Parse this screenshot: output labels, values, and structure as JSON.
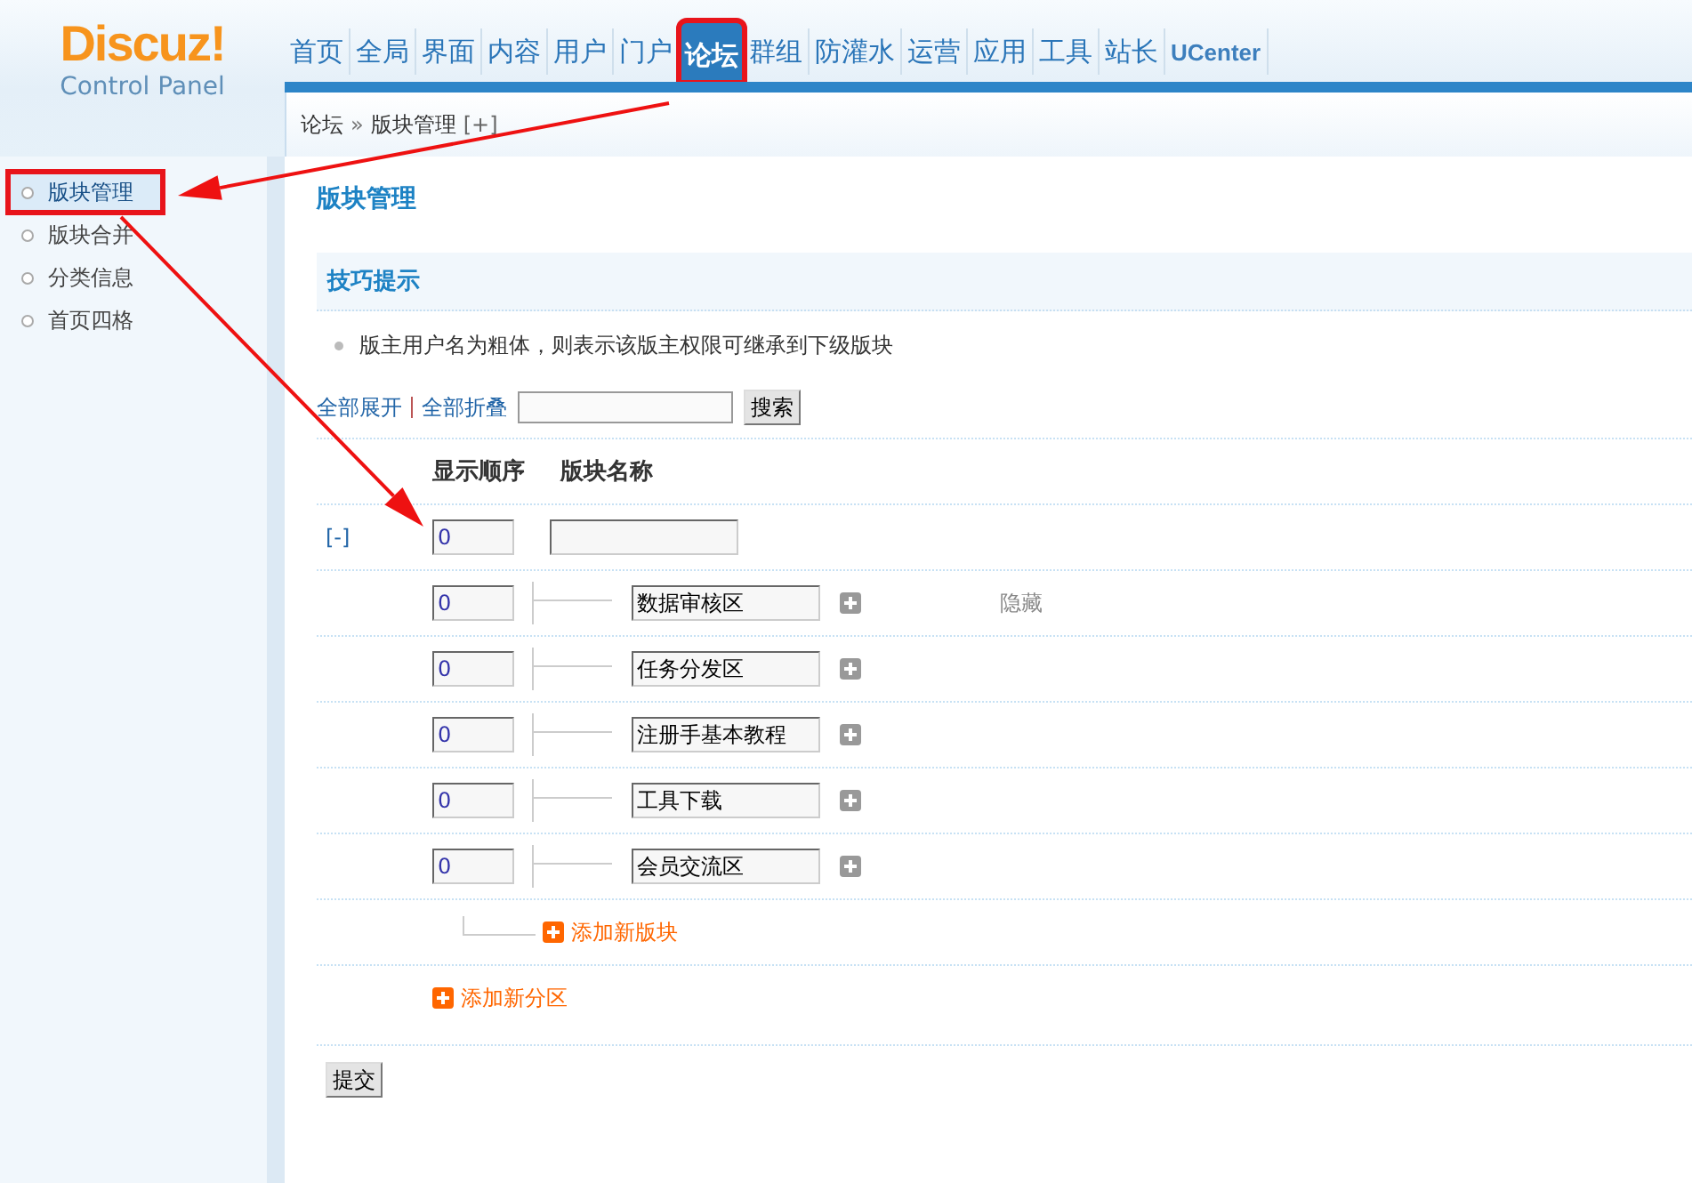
{
  "header": {
    "logo": "Discuz!",
    "subtitle": "Control Panel"
  },
  "nav": [
    {
      "label": "首页",
      "selected": false,
      "highlighted": false
    },
    {
      "label": "全局",
      "selected": false,
      "highlighted": false
    },
    {
      "label": "界面",
      "selected": false,
      "highlighted": false
    },
    {
      "label": "内容",
      "selected": false,
      "highlighted": false
    },
    {
      "label": "用户",
      "selected": false,
      "highlighted": false
    },
    {
      "label": "门户",
      "selected": false,
      "highlighted": false
    },
    {
      "label": "论坛",
      "selected": true,
      "highlighted": true
    },
    {
      "label": "群组",
      "selected": false,
      "highlighted": false
    },
    {
      "label": "防灌水",
      "selected": false,
      "highlighted": false
    },
    {
      "label": "运营",
      "selected": false,
      "highlighted": false
    },
    {
      "label": "应用",
      "selected": false,
      "highlighted": false
    },
    {
      "label": "工具",
      "selected": false,
      "highlighted": false
    },
    {
      "label": "站长",
      "selected": false,
      "highlighted": false
    },
    {
      "label": "UCenter",
      "selected": false,
      "highlighted": false
    }
  ],
  "breadcrumb": {
    "items": [
      "论坛",
      "版块管理"
    ],
    "separator": "»",
    "toggle": "[+]"
  },
  "sidebar": {
    "items": [
      {
        "label": "版块管理",
        "selected": true,
        "highlighted": true
      },
      {
        "label": "版块合并",
        "selected": false,
        "highlighted": false
      },
      {
        "label": "分类信息",
        "selected": false,
        "highlighted": false
      },
      {
        "label": "首页四格",
        "selected": false,
        "highlighted": false
      }
    ]
  },
  "main": {
    "title": "版块管理",
    "tips": {
      "title": "技巧提示",
      "items": [
        "版主用户名为粗体，则表示该版主权限可继承到下级版块"
      ]
    },
    "toolbar": {
      "expand_all": "全部展开",
      "collapse_all": "全部折叠",
      "search_button": "搜索"
    },
    "table": {
      "columns": [
        "显示顺序",
        "版块名称"
      ],
      "category": {
        "toggle": "[-]",
        "order": "0"
      },
      "forums": [
        {
          "order": "0",
          "name": "数据审核区",
          "status": "隐藏"
        },
        {
          "order": "0",
          "name": "任务分发区"
        },
        {
          "order": "0",
          "name": "注册手基本教程"
        },
        {
          "order": "0",
          "name": "工具下载"
        },
        {
          "order": "0",
          "name": "会员交流区"
        }
      ],
      "add_forum": "添加新版块",
      "add_category": "添加新分区"
    },
    "submit": "提交"
  },
  "annotations": [
    {
      "kind": "arrow"
    },
    {
      "kind": "arrow"
    }
  ]
}
